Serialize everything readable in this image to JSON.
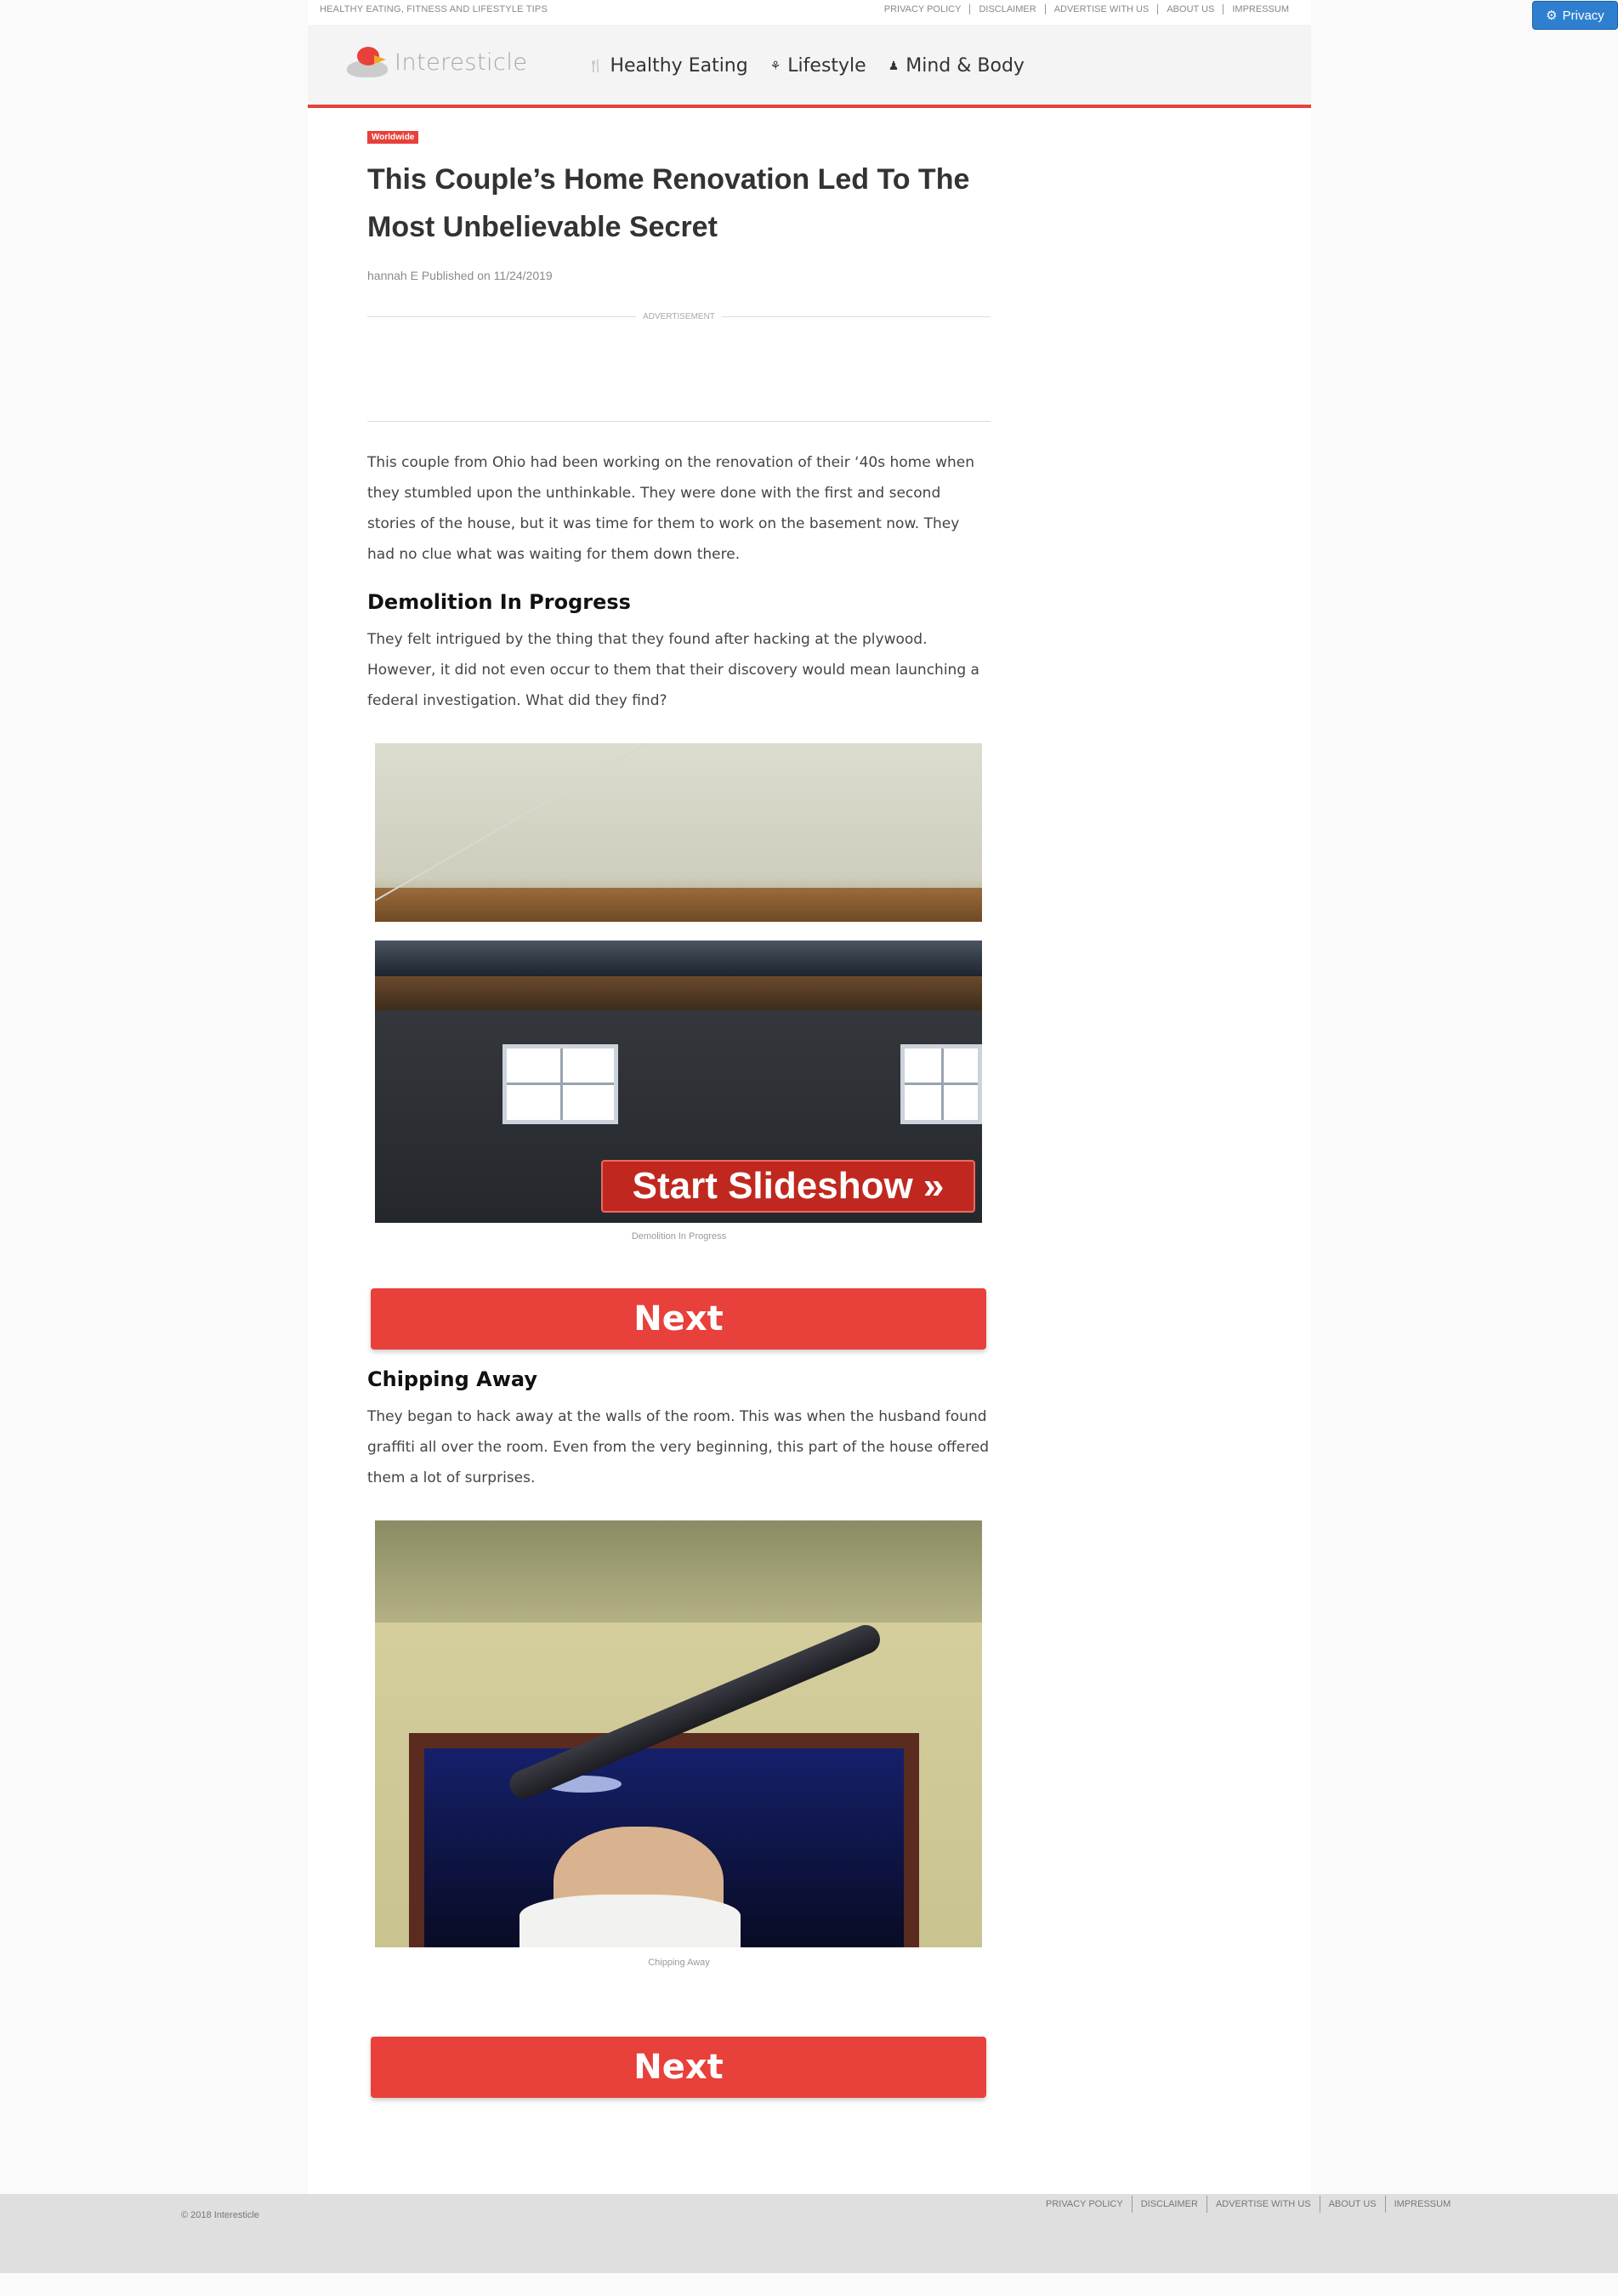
{
  "privacy_button": {
    "label": "Privacy",
    "icon": "gear-icon"
  },
  "topbar": {
    "tagline": "HEALTHY EATING, FITNESS AND LIFESTYLE TIPS",
    "links": [
      "PRIVACY POLICY",
      "DISCLAIMER",
      "ADVERTISE WITH US",
      "ABOUT US",
      "IMPRESSUM"
    ]
  },
  "header": {
    "logo_text": "Interesticle",
    "nav": [
      {
        "label": "Healthy Eating",
        "icon": "fork-knife-icon"
      },
      {
        "label": "Lifestyle",
        "icon": "lifestyle-icon"
      },
      {
        "label": "Mind & Body",
        "icon": "person-icon"
      }
    ]
  },
  "article": {
    "tag": "Worldwide",
    "title": "This Couple’s Home Renovation Led To The Most Unbelievable Secret",
    "byline": "hannah E Published on 11/24/2019",
    "ad_label": "ADVERTISEMENT",
    "intro": "This couple from Ohio had been working on the renovation of their ‘40s home when they stumbled upon the unthinkable. They were done with the first and second stories of the house, but it was time for them to work on the basement now. They had no clue what was waiting for them down there.",
    "sections": [
      {
        "heading": "Demolition In Progress",
        "text": "They felt intrigued by the thing that they found after hacking at the plywood. However, it did not even occur to them that their discovery would mean launching a federal investigation. What did they find?",
        "image_overlay": "Start Slideshow »",
        "caption": "Demolition In Progress",
        "button": "Next"
      },
      {
        "heading": "Chipping Away",
        "text": "They began to hack away at the walls of the room. This was when the husband found graffiti all over the room. Even from the very beginning, this part of the house offered them a lot of surprises.",
        "caption": "Chipping Away",
        "button": "Next"
      }
    ]
  },
  "footer": {
    "copyright": "© 2018 Interesticle",
    "links": [
      "PRIVACY POLICY",
      "DISCLAIMER",
      "ADVERTISE WITH US",
      "ABOUT US",
      "IMPRESSUM"
    ]
  },
  "colors": {
    "accent": "#e8403a",
    "privacy_blue": "#2f7fd1"
  }
}
